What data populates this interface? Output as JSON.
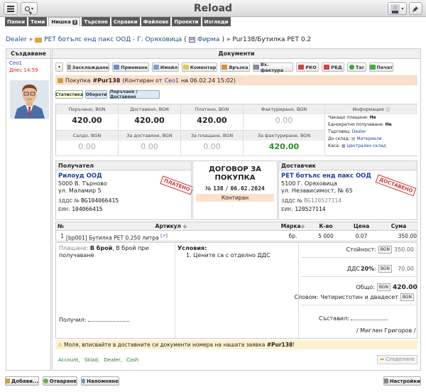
{
  "app_title": "Reload",
  "nav": [
    {
      "label": "Папки"
    },
    {
      "label": "Теми"
    },
    {
      "label": "Нишка",
      "help": "?"
    },
    {
      "label": "Търсене"
    },
    {
      "label": "Справки"
    },
    {
      "label": "Файлове"
    },
    {
      "label": "Проекти"
    },
    {
      "label": "Изгледи"
    }
  ],
  "breadcrumb": {
    "root": "Dealer",
    "sep": "»",
    "company": "PET ботълс енд пакс ООД - Г. Оряховица",
    "company_tag": "(",
    "company_type": "Фирма",
    "company_tag_end": ")",
    "current": "» Pur138/Бутилка PET 0.2"
  },
  "sidebar": {
    "header": "Създаване",
    "user": "Ceo1",
    "date": "Днес 14:59"
  },
  "docs": {
    "header": "Документи",
    "actions": [
      "Засклаждане",
      "Приемане",
      "Имейл",
      "Коментар",
      "Връзка",
      "Вх. фактура",
      "РКО",
      "РБД",
      "Таг",
      "Печат"
    ],
    "title_prefix": "Покупка",
    "doc_id": "#Pur138",
    "title_mid": "(Контиран от",
    "author": "Ceo1",
    "title_date": "на 06.02.24 15:02)",
    "subtabs": [
      "Статистика",
      "Обороти",
      "Поръчано / Доставено"
    ]
  },
  "summary": {
    "row1": [
      {
        "label": "Поръчано, BGN",
        "value": "420.00"
      },
      {
        "label": "Доставено, BGN",
        "value": "420.00"
      },
      {
        "label": "Платено, BGN",
        "value": "420.00"
      },
      {
        "label": "Фактурирано, BGN",
        "value": "0.00"
      }
    ],
    "row2": [
      {
        "label": "Салдо, BGN",
        "value": "0.00"
      },
      {
        "label": "За доставяне, BGN",
        "value": "0.00"
      },
      {
        "label": "За плащане, BGN",
        "value": "0.00"
      },
      {
        "label": "За фактуриране, BGN",
        "value": "420.00"
      }
    ],
    "info": {
      "header": "Информация",
      "waiting_label": "Чакащо плащане:",
      "waiting": "Не",
      "one_time_label": "Еднократно получаване:",
      "one_time": "Не",
      "trader_label": "Търговец:",
      "trader": "Dealer",
      "store_label": "До склад:",
      "store": "Материали",
      "cash_label": "Каса:",
      "cash": "Централен склад"
    }
  },
  "receiver": {
    "header": "Получател",
    "name": "Рилоуд ООД",
    "city": "5000 В. Търново",
    "street": "ул. Маламир 5",
    "vat_label": "ЗДДС №",
    "vat": "BG104066415",
    "eik_label": "ЕИК:",
    "eik": "104066415",
    "stamp": "ПЛАТЕНО"
  },
  "contract": {
    "title": "ДОГОВОР ЗА ПОКУПКА",
    "no_label": "№",
    "number": "138",
    "slash": "/",
    "date": "06.02.2024",
    "status": "Контиран"
  },
  "supplier": {
    "header": "Доставчик",
    "name": "PET ботълс енд пакс ООД",
    "city": "5100 Г. Оряховица",
    "street": "ул. Независимост, № 65",
    "vat_label": "ЗДДС №",
    "vat": "BG120527114",
    "eik_label": "ЕИК:",
    "eik": "120527114",
    "stamp": "ДОСТАВЕНО"
  },
  "items": {
    "headers": {
      "no": "№",
      "article": "Артикул",
      "unit": "Мярка",
      "qty": "К-во",
      "price": "Цена",
      "sum": "Сума"
    },
    "rows": [
      {
        "no": "1",
        "code": "bp001",
        "name": "Бутилка PET 0.250 литра",
        "ext": "[↗]",
        "unit": "бр.",
        "qty": "5 000",
        "price": "0.07",
        "sum": "350.00"
      }
    ]
  },
  "footer": {
    "payment_label": "Плащане:",
    "payment_value": "В брой",
    "payment_rest": ", В брой при получаване",
    "conditions_label": "Условия:",
    "conditions": [
      "1. Цените са с отделно ДДС"
    ],
    "value_label": "Стойност:",
    "value": "350.00",
    "vat_label": "ДДС",
    "vat_rate": "20%",
    "vat_colon": ":",
    "vat": "70.00",
    "total_label": "Общо:",
    "total": "420.00",
    "words_label": "Словом:",
    "words": "Четиристотин и двадесет",
    "currency": "BGN",
    "receiver_sign_label": "Получил:",
    "author_sign_label": "Съставил:",
    "author_sign": "/ Миглен Григоров /"
  },
  "warning": {
    "text": "Моля, вписвайте в доставните си документи номера на нашата заявка",
    "ref": "#Pur138",
    "end": "!"
  },
  "tags": [
    "Account,",
    "Sklad,",
    "Dealer,",
    "Cash"
  ],
  "share_label": "Споделяне",
  "bottom": {
    "add": "Добави...",
    "open": "Отваряне",
    "reminder": "Напомняне",
    "settings": "Настройки"
  }
}
